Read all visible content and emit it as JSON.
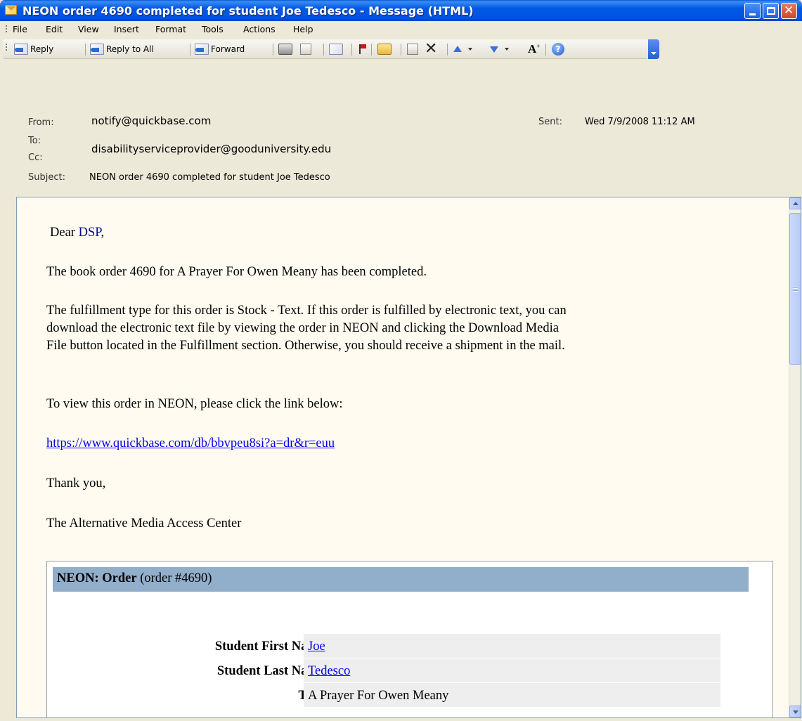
{
  "window": {
    "title": "NEON order 4690 completed for student Joe Tedesco - Message (HTML)"
  },
  "menu": [
    "File",
    "Edit",
    "View",
    "Insert",
    "Format",
    "Tools",
    "Actions",
    "Help"
  ],
  "toolbar": {
    "reply": "Reply",
    "reply_all": "Reply to All",
    "forward": "Forward"
  },
  "header": {
    "from_label": "From:",
    "from": "notify@quickbase.com",
    "to_label": "To:",
    "to": "disabilityserviceprovider@gooduniversity.edu",
    "cc_label": "Cc:",
    "subject_label": "Subject:",
    "subject": "NEON order 4690 completed for student Joe Tedesco",
    "sent_label": "Sent:",
    "sent": "Wed 7/9/2008 11:12 AM"
  },
  "body": {
    "greeting_prefix": "Dear ",
    "greeting_name": "DSP",
    "greeting_suffix": ",",
    "para1": "The book order 4690 for A Prayer For Owen Meany has been completed.",
    "para2_line1": "The fulfillment type for this order is Stock - Text.  If this order is fulfilled by electronic text, you can",
    "para2_line2": "download the electronic text file by viewing the order in NEON and clicking the Download Media",
    "para2_line3": "File button located in the Fulfillment section.  Otherwise, you should receive a shipment in the mail.",
    "para3": "To view this order in NEON, please click the link below:",
    "link": "https://www.quickbase.com/db/bbvpeu8si?a=dr&r=euu",
    "thanks": "Thank you,",
    "signature": "The Alternative Media Access Center"
  },
  "order": {
    "heading_bold": "NEON: Order",
    "heading_rest": " (order #4690)",
    "rows": [
      {
        "label": "Student First Name",
        "value": "Joe",
        "is_link": true
      },
      {
        "label": "Student Last Name",
        "value": "Tedesco",
        "is_link": true
      },
      {
        "label": "Title",
        "value": "A Prayer For Owen Meany",
        "is_link": false
      }
    ]
  }
}
